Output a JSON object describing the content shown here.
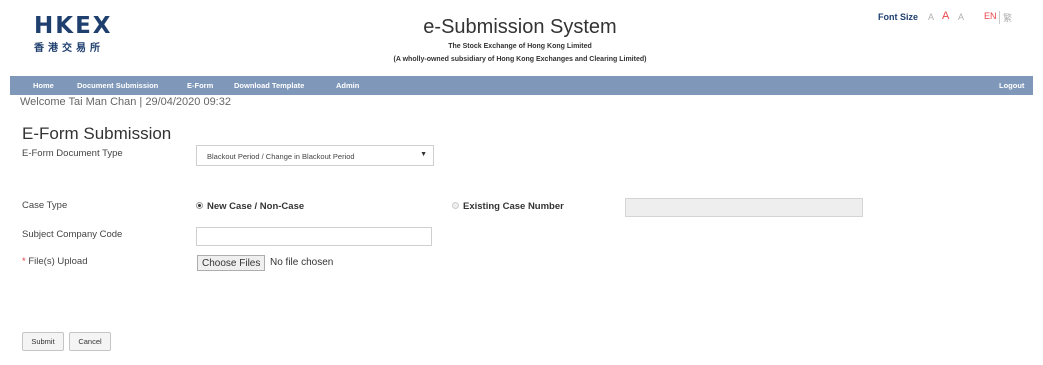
{
  "header": {
    "logo_text": "HKEX",
    "logo_cn": "香港交易所",
    "title": "e-Submission System",
    "subtitle1": "The Stock Exchange of Hong Kong Limited",
    "subtitle2": "(A wholly-owned subsidiary of Hong Kong Exchanges and Clearing Limited)",
    "font_size_label": "Font Size",
    "font_a_small": "A",
    "font_a_medium": "A",
    "font_a_large": "A",
    "lang_en": "EN",
    "lang_tc": "繁"
  },
  "nav": {
    "home": "Home",
    "document_submission": "Document Submission",
    "eform": "E-Form",
    "download_template": "Download Template",
    "admin": "Admin",
    "logout": "Logout"
  },
  "welcome": "Welcome Tai Man Chan | 29/04/2020 09:32",
  "form": {
    "title": "E-Form Submission",
    "doc_type_label": "E-Form Document Type",
    "doc_type_value": "Blackout Period / Change in Blackout Period",
    "case_type_label": "Case Type",
    "case_new_label": "New Case / Non-Case",
    "case_existing_label": "Existing Case Number",
    "existing_case_value": "",
    "subject_company_label": "Subject Company Code",
    "subject_company_value": "",
    "file_upload_required": "*",
    "file_upload_label": " File(s) Upload",
    "choose_files_label": "Choose Files",
    "no_file_text": "No file chosen",
    "submit_label": "Submit",
    "cancel_label": "Cancel"
  },
  "colors": {
    "navbar": "#7f98b9",
    "brand": "#1f3f6e",
    "required": "#e03c3c"
  }
}
